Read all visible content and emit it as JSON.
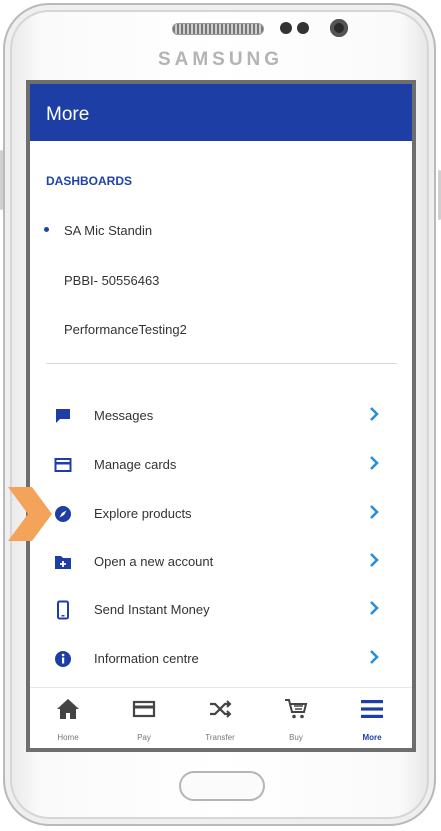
{
  "device": {
    "brand": "SAMSUNG"
  },
  "appbar": {
    "title": "More"
  },
  "dashboards": {
    "title": "DASHBOARDS",
    "items": [
      {
        "label": "SA Mic Standin",
        "selected": true
      },
      {
        "label": "PBBI- 50556463",
        "selected": false
      },
      {
        "label": "PerformanceTesting2",
        "selected": false
      }
    ]
  },
  "menu": {
    "items": [
      {
        "label": "Messages",
        "icon": "message-icon"
      },
      {
        "label": "Manage cards",
        "icon": "card-icon"
      },
      {
        "label": "Explore products",
        "icon": "compass-icon"
      },
      {
        "label": "Open a new account",
        "icon": "folder-add-icon"
      },
      {
        "label": "Send Instant Money",
        "icon": "phone-icon"
      },
      {
        "label": "Information centre",
        "icon": "info-icon"
      }
    ]
  },
  "tabs": [
    {
      "label": "Home",
      "icon": "home-icon",
      "active": false
    },
    {
      "label": "Pay",
      "icon": "card-icon",
      "active": false
    },
    {
      "label": "Transfer",
      "icon": "shuffle-icon",
      "active": false
    },
    {
      "label": "Buy",
      "icon": "cart-icon",
      "active": false
    },
    {
      "label": "More",
      "icon": "menu-icon",
      "active": true
    }
  ],
  "colors": {
    "primary": "#1d3fa5",
    "accent": "#2a8fd6",
    "pointer": "#f3a35a"
  }
}
